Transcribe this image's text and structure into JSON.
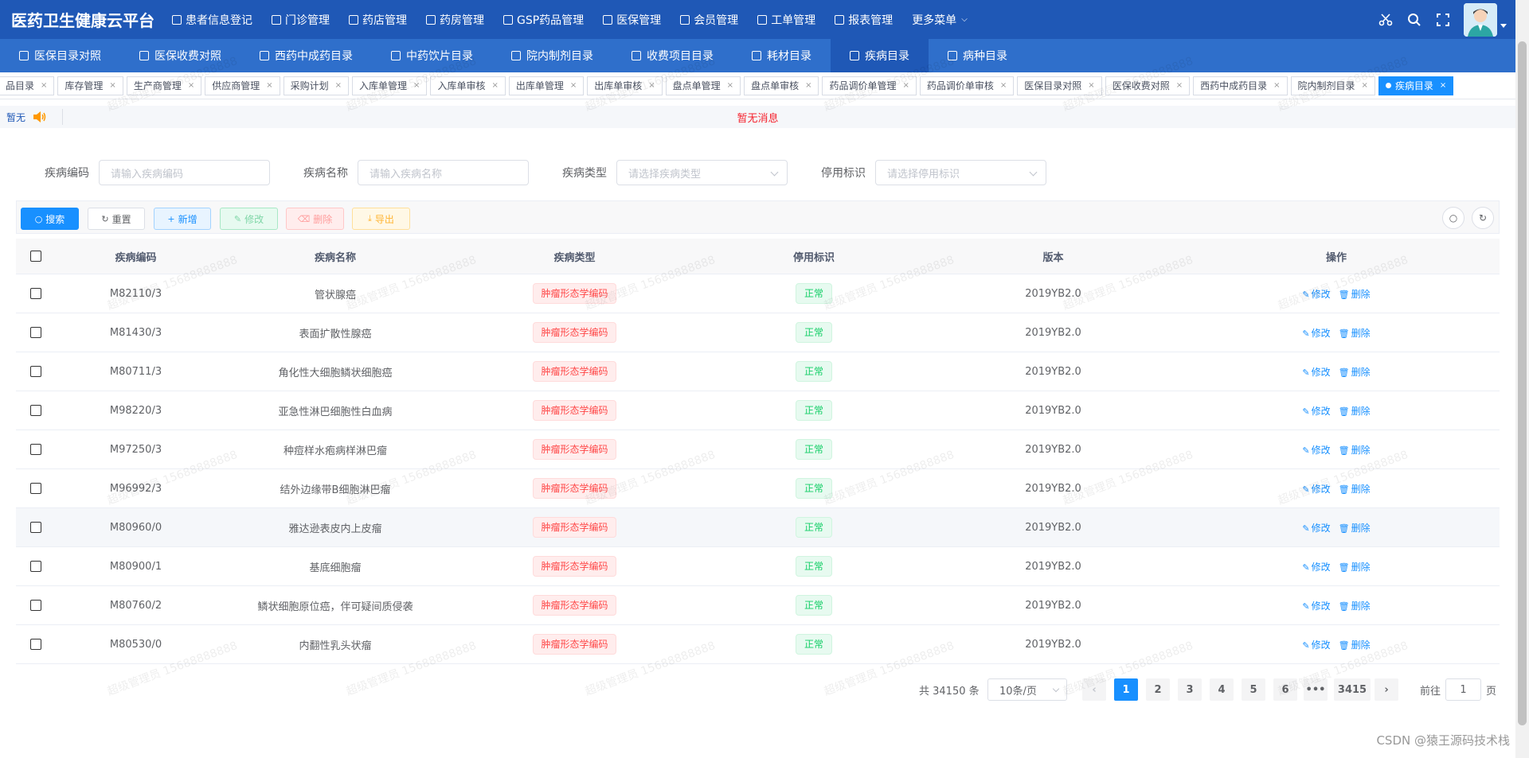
{
  "app": {
    "title": "医药卫生健康云平台"
  },
  "top_menu": [
    {
      "label": "患者信息登记",
      "icon": "user-icon"
    },
    {
      "label": "门诊管理",
      "icon": "clinic-icon"
    },
    {
      "label": "药店管理",
      "icon": "store-icon"
    },
    {
      "label": "药房管理",
      "icon": "pharmacy-icon"
    },
    {
      "label": "GSP药品管理",
      "icon": "list-icon"
    },
    {
      "label": "医保管理",
      "icon": "insurance-icon"
    },
    {
      "label": "会员管理",
      "icon": "member-icon"
    },
    {
      "label": "工单管理",
      "icon": "order-icon"
    },
    {
      "label": "报表管理",
      "icon": "chart-icon"
    },
    {
      "label": "更多菜单",
      "icon": "chevron-down-icon"
    }
  ],
  "sub_nav": [
    {
      "label": "医保目录对照"
    },
    {
      "label": "医保收费对照"
    },
    {
      "label": "西药中成药目录"
    },
    {
      "label": "中药饮片目录"
    },
    {
      "label": "院内制剂目录"
    },
    {
      "label": "收费项目目录"
    },
    {
      "label": "耗材目录"
    },
    {
      "label": "疾病目录",
      "active": true
    },
    {
      "label": "病种目录"
    }
  ],
  "tabs": [
    {
      "label": "品目录"
    },
    {
      "label": "库存管理"
    },
    {
      "label": "生产商管理"
    },
    {
      "label": "供应商管理"
    },
    {
      "label": "采购计划"
    },
    {
      "label": "入库单管理"
    },
    {
      "label": "入库单审核"
    },
    {
      "label": "出库单管理"
    },
    {
      "label": "出库单审核"
    },
    {
      "label": "盘点单管理"
    },
    {
      "label": "盘点单审核"
    },
    {
      "label": "药品调价单管理"
    },
    {
      "label": "药品调价单审核"
    },
    {
      "label": "医保目录对照"
    },
    {
      "label": "医保收费对照"
    },
    {
      "label": "西药中成药目录"
    },
    {
      "label": "院内制剂目录"
    },
    {
      "label": "疾病目录",
      "active": true
    }
  ],
  "notice": {
    "label": "暂无",
    "message": "暂无消息"
  },
  "filters": {
    "code": {
      "label": "疾病编码",
      "placeholder": "请输入疾病编码"
    },
    "name": {
      "label": "疾病名称",
      "placeholder": "请输入疾病名称"
    },
    "type": {
      "label": "疾病类型",
      "placeholder": "请选择疾病类型"
    },
    "status": {
      "label": "停用标识",
      "placeholder": "请选择停用标识"
    }
  },
  "toolbar": {
    "search": "搜索",
    "reset": "重置",
    "add": "新增",
    "edit": "修改",
    "delete": "删除",
    "export": "导出"
  },
  "table": {
    "columns": [
      "疾病编码",
      "疾病名称",
      "疾病类型",
      "停用标识",
      "版本",
      "操作"
    ],
    "action_edit": "修改",
    "action_delete": "删除",
    "rows": [
      {
        "code": "M82110/3",
        "name": "管状腺癌",
        "type": "肿瘤形态学编码",
        "status": "正常",
        "version": "2019YB2.0"
      },
      {
        "code": "M81430/3",
        "name": "表面扩散性腺癌",
        "type": "肿瘤形态学编码",
        "status": "正常",
        "version": "2019YB2.0"
      },
      {
        "code": "M80711/3",
        "name": "角化性大细胞鳞状细胞癌",
        "type": "肿瘤形态学编码",
        "status": "正常",
        "version": "2019YB2.0"
      },
      {
        "code": "M98220/3",
        "name": "亚急性淋巴细胞性白血病",
        "type": "肿瘤形态学编码",
        "status": "正常",
        "version": "2019YB2.0"
      },
      {
        "code": "M97250/3",
        "name": "种痘样水疱病样淋巴瘤",
        "type": "肿瘤形态学编码",
        "status": "正常",
        "version": "2019YB2.0"
      },
      {
        "code": "M96992/3",
        "name": "结外边缘带B细胞淋巴瘤",
        "type": "肿瘤形态学编码",
        "status": "正常",
        "version": "2019YB2.0"
      },
      {
        "code": "M80960/0",
        "name": "雅达逊表皮内上皮瘤",
        "type": "肿瘤形态学编码",
        "status": "正常",
        "version": "2019YB2.0"
      },
      {
        "code": "M80900/1",
        "name": "基底细胞瘤",
        "type": "肿瘤形态学编码",
        "status": "正常",
        "version": "2019YB2.0"
      },
      {
        "code": "M80760/2",
        "name": "鳞状细胞原位癌，伴可疑间质侵袭",
        "type": "肿瘤形态学编码",
        "status": "正常",
        "version": "2019YB2.0"
      },
      {
        "code": "M80530/0",
        "name": "内翻性乳头状瘤",
        "type": "肿瘤形态学编码",
        "status": "正常",
        "version": "2019YB2.0"
      }
    ]
  },
  "pagination": {
    "total": "共 34150 条",
    "page_size": "10条/页",
    "pages": [
      "1",
      "2",
      "3",
      "4",
      "5",
      "6"
    ],
    "ellipsis": "•••",
    "last": "3415",
    "current": "1",
    "goto_label": "前往",
    "goto_value": "1",
    "page_suffix": "页"
  },
  "watermark": "超级管理员 15688888888",
  "footer": "CSDN @猿王源码技术栈"
}
